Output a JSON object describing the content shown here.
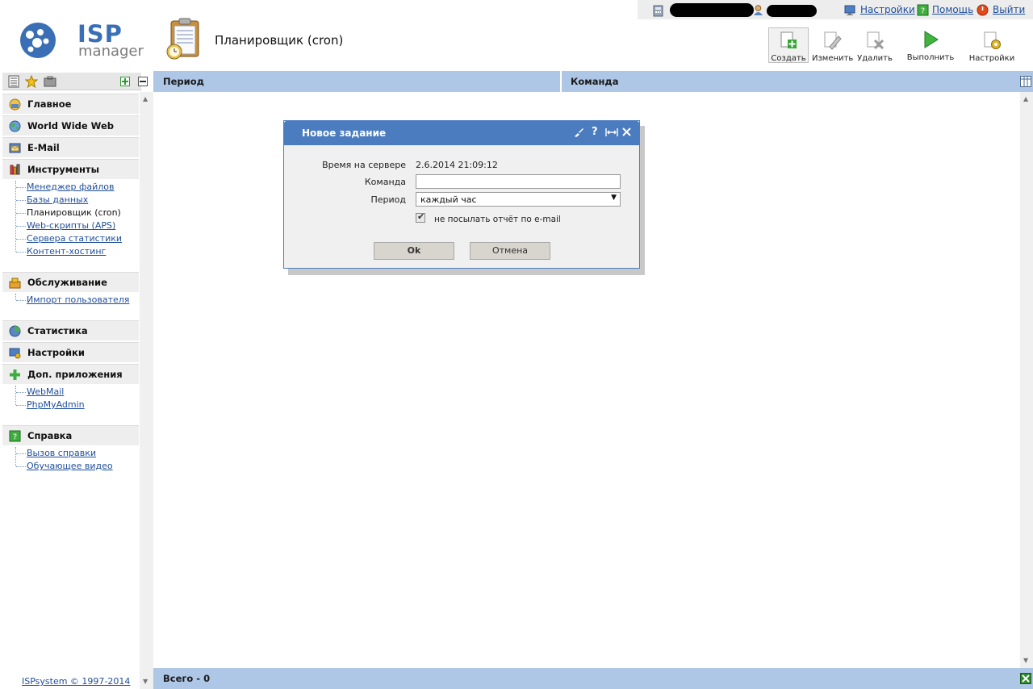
{
  "top": {
    "settings_link": "Настройки",
    "help_link": "Помощь",
    "logout_link": "Выйти"
  },
  "logo": {
    "line1": "ISP",
    "line2": "manager"
  },
  "page": {
    "title": "Планировщик (cron)"
  },
  "toolbar": {
    "create": "Создать",
    "edit": "Изменить",
    "delete": "Удалить",
    "run": "Выполнить",
    "settings": "Настройки"
  },
  "sidebar": {
    "sections": {
      "main": "Главное",
      "www": "World Wide Web",
      "email": "E-Mail",
      "tools": "Инструменты",
      "service": "Обслуживание",
      "stats": "Статистика",
      "settings": "Настройки",
      "apps": "Доп. приложения",
      "help": "Справка"
    },
    "tools_items": [
      "Менеджер файлов",
      "Базы данных",
      "Планировщик (cron)",
      "Web-скрипты (APS)",
      "Сервера статистики",
      "Контент-хостинг"
    ],
    "service_items": [
      "Импорт пользователя"
    ],
    "apps_items": [
      "WebMail",
      "PhpMyAdmin"
    ],
    "help_items": [
      "Вызов справки",
      "Обучающее видео"
    ],
    "copyright": "ISPsystem © 1997-2014"
  },
  "table": {
    "columns": [
      "Период",
      "Команда"
    ],
    "footer": "Всего - 0"
  },
  "dialog": {
    "title": "Новое задание",
    "server_time_label": "Время на сервере",
    "server_time_value": "2.6.2014 21:09:12",
    "command_label": "Команда",
    "command_value": "",
    "period_label": "Период",
    "period_value": "каждый час",
    "no_email_checked": true,
    "no_email_label": "не посылать отчёт по e-mail",
    "ok_button": "Ok",
    "cancel_button": "Отмена"
  }
}
